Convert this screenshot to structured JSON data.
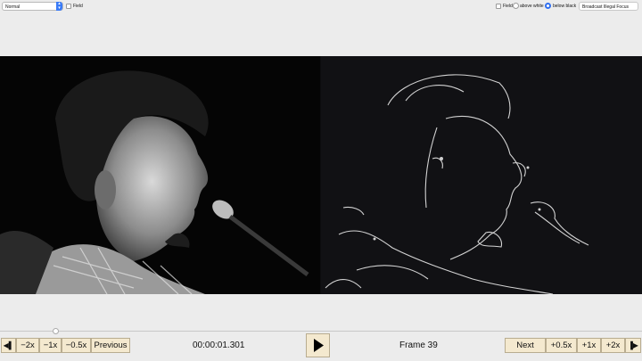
{
  "top_left": {
    "mode_select_value": "Normal",
    "field_label": "Field"
  },
  "top_right": {
    "field_label": "Field",
    "radio_above_label": "above white",
    "radio_below_label": "below black",
    "selected_radio": "below black",
    "filter_select_value": "Broadcast Illegal Focus"
  },
  "transport": {
    "btn_step_back": "◀▌",
    "btn_m2x": "−2x",
    "btn_m1x": "−1x",
    "btn_m05x": "−0.5x",
    "btn_previous": "Previous",
    "timecode": "00:00:01.301",
    "frame_label": "Frame 39",
    "btn_next": "Next",
    "btn_p05x": "+0.5x",
    "btn_p1x": "+1x",
    "btn_p2x": "+2x",
    "btn_step_fwd": "▐▶"
  },
  "colors": {
    "accent": "#3a7bf7",
    "button_bg": "#f4e9cf",
    "window_bg": "#ececec"
  }
}
